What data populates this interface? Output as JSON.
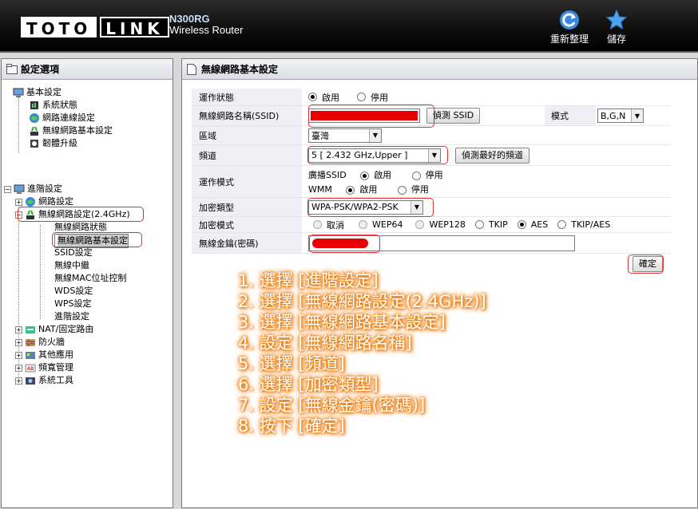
{
  "header": {
    "brand_left": "TOTO",
    "brand_right": "LINK",
    "model": "N300RG",
    "subtitle": "Wireless Router",
    "refresh_label": "重新整理",
    "save_label": "儲存"
  },
  "left_panel": {
    "title": "設定選項",
    "tree": [
      {
        "label": "基本設定",
        "level": 0,
        "icon": "computer-icon"
      },
      {
        "label": "系統狀態",
        "level": 1,
        "icon": "status-icon"
      },
      {
        "label": "網路連線設定",
        "level": 1,
        "icon": "globe-icon"
      },
      {
        "label": "無線網路基本設定",
        "level": 1,
        "icon": "wireless-icon"
      },
      {
        "label": "韌體升級",
        "level": 1,
        "icon": "upgrade-icon"
      },
      {
        "label": "進階設定",
        "level": 0,
        "icon": "computer-icon"
      },
      {
        "label": "網路設定",
        "level": 1,
        "icon": "globe-icon"
      },
      {
        "label": "無線網路設定(2.4GHz)",
        "level": 1,
        "icon": "wireless-icon"
      },
      {
        "label": "無線網路狀態",
        "level": 2
      },
      {
        "label": "無線網路基本設定",
        "level": 2
      },
      {
        "label": "SSID設定",
        "level": 2
      },
      {
        "label": "無線中繼",
        "level": 2
      },
      {
        "label": "無線MAC位址控制",
        "level": 2
      },
      {
        "label": "WDS設定",
        "level": 2
      },
      {
        "label": "WPS設定",
        "level": 2
      },
      {
        "label": "進階設定",
        "level": 2
      },
      {
        "label": "NAT/固定路由",
        "level": 1,
        "icon": "nat-icon"
      },
      {
        "label": "防火牆",
        "level": 1,
        "icon": "firewall-icon"
      },
      {
        "label": "其他應用",
        "level": 1,
        "icon": "apps-icon"
      },
      {
        "label": "頻寬管理",
        "level": 1,
        "icon": "bandwidth-icon"
      },
      {
        "label": "系統工具",
        "level": 1,
        "icon": "tools-icon"
      }
    ]
  },
  "main": {
    "title": "無線網路基本設定",
    "form": {
      "status_label": "運作狀態",
      "enable": "啟用",
      "disable": "停用",
      "ssid_label": "無線網路名稱(SSID)",
      "detect_ssid": "偵測 SSID",
      "mode_label": "模式",
      "mode_value": "B,G,N",
      "region_label": "區域",
      "region_value": "臺灣",
      "channel_label": "頻道",
      "channel_value": "5 [ 2.432 GHz,Upper ]",
      "detect_channel": "偵測最好的頻道",
      "op_mode_label": "運作模式",
      "broadcast_ssid": "廣播SSID",
      "wmm": "WMM",
      "enc_type_label": "加密類型",
      "enc_type_value": "WPA-PSK/WPA2-PSK",
      "enc_mode_label": "加密模式",
      "enc_cancel": "取消",
      "enc_wep64": "WEP64",
      "enc_wep128": "WEP128",
      "enc_tkip": "TKIP",
      "enc_aes": "AES",
      "enc_tkipaes": "TKIP/AES",
      "key_label": "無線金鑰(密碼)",
      "confirm": "確定"
    },
    "instructions": [
      "1. 選擇 [進階設定]",
      "2. 選擇 [無線網路設定(2.4GHz)]",
      "3. 選擇 [無線網路基本設定]",
      "4. 設定 [無線網路名稱]",
      "5. 選擇 [頻道]",
      "6. 選擇 [加密類型]",
      "7. 設定 [無線金鑰(密碼)]",
      "8. 按下 [確定]"
    ]
  },
  "colors": {
    "highlight": "#d33333",
    "redacted": "#e60000",
    "instruction_glow": "#f07800"
  }
}
